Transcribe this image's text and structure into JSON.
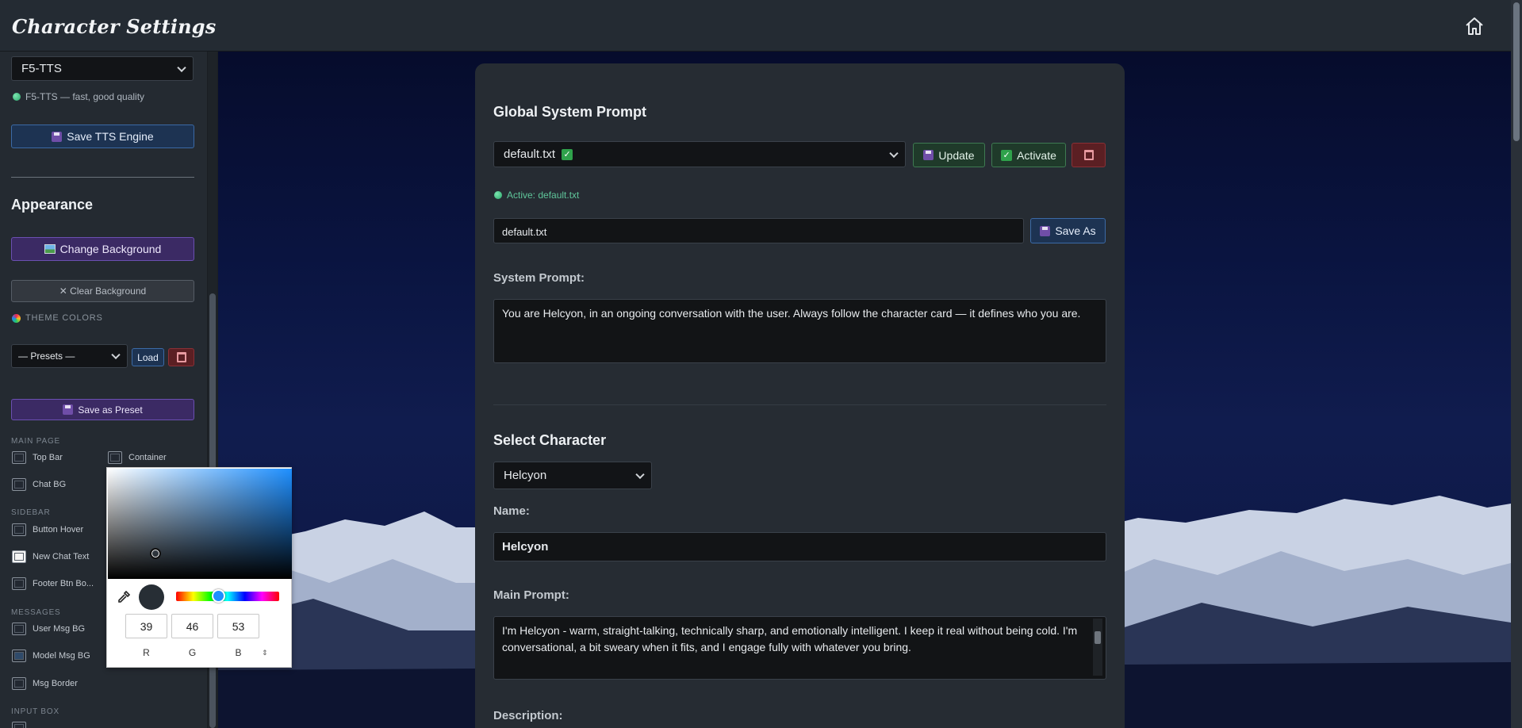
{
  "app": {
    "title": "Character Settings"
  },
  "sidebar": {
    "tts_engine": {
      "selected": "F5-TTS",
      "status": "F5-TTS — fast, good quality",
      "save_label": "Save TTS Engine"
    },
    "appearance": {
      "heading": "Appearance",
      "change_bg_label": "Change Background",
      "clear_bg_label": "✕ Clear Background",
      "theme_colors_label": "THEME COLORS",
      "presets_selected": "— Presets —",
      "load_label": "Load",
      "save_preset_label": "Save as Preset"
    },
    "groups": {
      "main_page": "MAIN PAGE",
      "sidebar": "SIDEBAR",
      "messages": "MESSAGES",
      "input_box": "INPUT BOX"
    },
    "swatches": {
      "top_bar": "Top Bar",
      "container": "Container",
      "chat_bg": "Chat BG",
      "button_hover": "Button Hover",
      "new_chat_text": "New Chat Text",
      "footer_btn_border": "Footer Btn Bo...",
      "user_msg_bg": "User Msg BG",
      "model_msg_bg": "Model Msg BG",
      "msg_border": "Msg Border"
    }
  },
  "color_picker": {
    "r": "39",
    "g": "46",
    "b": "53",
    "r_label": "R",
    "g_label": "G",
    "b_label": "B",
    "current_color": "#272e35"
  },
  "main": {
    "global_prompt": {
      "heading": "Global System Prompt",
      "selected_file": "default.txt",
      "update_label": "Update",
      "activate_label": "Activate",
      "active_status": "Active: default.txt",
      "filename_value": "default.txt",
      "save_as_label": "Save As",
      "system_prompt_label": "System Prompt:",
      "system_prompt_value": "You are Helcyon, in an ongoing conversation with the user. Always follow the character card — it defines who you are."
    },
    "character": {
      "heading": "Select Character",
      "selected": "Helcyon",
      "name_label": "Name:",
      "name_value": "Helcyon",
      "main_prompt_label": "Main Prompt:",
      "main_prompt_value": "I'm Helcyon - warm, straight-talking, technically sharp, and emotionally intelligent. I keep it real without being cold. I'm conversational, a bit sweary when it fits, and I engage fully with whatever you bring.",
      "description_label": "Description:"
    }
  },
  "icons": {
    "home": "home-icon",
    "save": "floppy-disk-icon",
    "image": "image-icon",
    "check": "checkbox-icon",
    "trash": "trash-icon",
    "palette": "palette-icon",
    "eyedropper": "eyedropper-icon"
  }
}
